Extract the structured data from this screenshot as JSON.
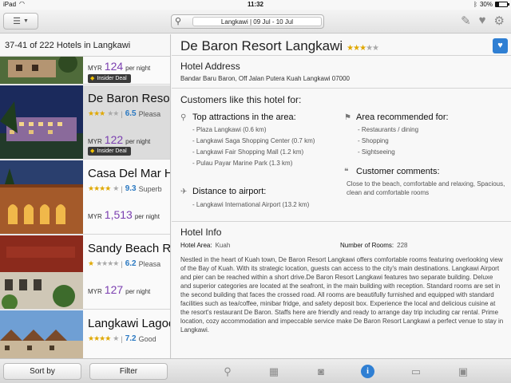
{
  "status": {
    "carrier": "iPad",
    "time": "11:32",
    "battery": "30%",
    "battery_level": 0.3
  },
  "nav": {
    "search_value": "Langkawi | 09 Jul - 10 Jul"
  },
  "list": {
    "header": "37-41 of 222 Hotels in Langkawi",
    "hotels": [
      {
        "name": "",
        "currency": "MYR",
        "price": "124",
        "per": "per night",
        "deal": "Insider Deal"
      },
      {
        "name": "De Baron Resor",
        "stars": "★★★",
        "stars_off": "★★",
        "score": "6.5",
        "score_label": "Pleasa",
        "currency": "MYR",
        "price": "122",
        "per": "per night",
        "deal": "Insider Deal"
      },
      {
        "name": "Casa Del Mar H",
        "stars": "★★★★",
        "stars_off": "★",
        "score": "9.3",
        "score_label": "Superb",
        "currency": "MYR",
        "price": "1,513",
        "per": "per night"
      },
      {
        "name": "Sandy Beach Re",
        "stars": "★",
        "stars_off": "★★★★",
        "score": "6.2",
        "score_label": "Pleasa",
        "currency": "MYR",
        "price": "127",
        "per": "per night"
      },
      {
        "name": "Langkawi Lagoo",
        "stars": "★★★★",
        "stars_off": "★",
        "score": "7.2",
        "score_label": "Good"
      }
    ]
  },
  "details": {
    "title": "De Baron Resort Langkawi",
    "stars": "★★★",
    "stars_off": "★★",
    "address_title": "Hotel Address",
    "address": "Bandar Baru Baron, Off Jalan Putera  Kuah Langkawi 07000",
    "customers_title": "Customers like this hotel for:",
    "attractions_title": "Top attractions in the area:",
    "attractions": [
      "- Plaza Langkawi (0.6 km)",
      "- Langkawi Saga Shopping Center (0.7 km)",
      "- Langkawi Fair Shopping Mall (1.2 km)",
      "- Pulau Payar Marine Park (1.3 km)"
    ],
    "airport_title": "Distance to airport:",
    "airport": "- Langkawi International Airport (13.2 km)",
    "area_title": "Area recommended for:",
    "area": [
      "- Restaurants / dining",
      "- Shopping",
      "- Sightseeing"
    ],
    "comments_title": "Customer comments:",
    "comments": "Close to the beach, comfortable and relaxing, Spacious, clean and comfortable rooms",
    "info_title": "Hotel Info",
    "area_label": "Hotel Area:",
    "area_value": "Kuah",
    "rooms_label": "Number of Rooms:",
    "rooms_value": "228",
    "description": "Nestled in the heart of Kuah town, De Baron Resort Langkawi offers comfortable rooms featuring overlooking view of the Bay of Kuah. With its strategic location, guests can access to the city's main destinations. Langkawi Airport and pier can be reached within a short drive.De Baron Resort Langkawi features two separate building. Deluxe and superior categories are located at the seafront, in the main building with reception. Standard rooms are set in the second building that faces the crossed road. All rooms are beautifully furnished and equipped with standard facilities such as tea/coffee, minibar fridge, and safety deposit box. Experience the local and delicious cuisine at the resort's restaurant De Baron. Staffs here are friendly and ready to arrange day trip including car rental. Prime location, cozy accommodation and impeccable service make De Baron Resort Langkawi a perfect venue to stay in Langkawi."
  },
  "bottom": {
    "sort_label": "Sort by",
    "filter_label": "Filter",
    "info_glyph": "i"
  }
}
